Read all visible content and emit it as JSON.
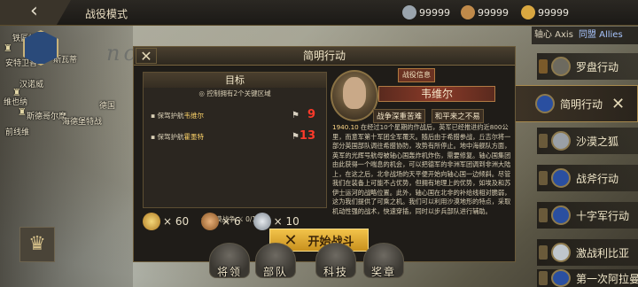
{
  "topbar": {
    "back_icon": "back-arrow-icon",
    "mode_title": "战役模式",
    "resources": [
      {
        "icon": "medal-silver-icon",
        "value": "99999",
        "color": "#9aa4ad"
      },
      {
        "icon": "medal-bronze-icon",
        "value": "99999",
        "color": "#c08a4a"
      },
      {
        "icon": "medal-gold-icon",
        "value": "99999",
        "color": "#d9a740"
      }
    ]
  },
  "map": {
    "labels": [
      "铁匠加州",
      "安特卫普",
      "汉诺威",
      "维也纳",
      "斯德哥尔摩",
      "前线维",
      "斯瓦蒂",
      "德国",
      "海德堡特战"
    ],
    "watermark": "nce"
  },
  "factions": {
    "tab_axis": "轴心 Axis",
    "tab_allies": "同盟 Allies",
    "operations": [
      {
        "name": "罗盘行动",
        "flag_color": "#6d6a5f"
      },
      {
        "name": "简明行动",
        "flag_color": "#2a4fa0"
      },
      {
        "name": "沙漠之狐",
        "flag_color": "#9aa0a6"
      },
      {
        "name": "战斧行动",
        "flag_color": "#2a4fa0"
      },
      {
        "name": "十字军行动",
        "flag_color": "#2a4fa0"
      },
      {
        "name": "激战利比亚",
        "flag_color": "#bfc6cc"
      },
      {
        "name": "第一次阿拉曼",
        "flag_color": "#2a4fa0"
      }
    ]
  },
  "dialog": {
    "title": "简明行动",
    "close_icon": "close-icon",
    "target": {
      "heading": "目标",
      "desc": "控制拥有2个关键区域",
      "objectives": [
        {
          "prefix": "保驾护航",
          "place": "韦维尔",
          "value": "9"
        },
        {
          "prefix": "保驾护航",
          "place": "霍墨特",
          "value": "13"
        }
      ],
      "progress_label": "沙漠战争",
      "progress_value": "0/1000"
    },
    "rewards": [
      {
        "icon": "medal-gold-icon",
        "value": "× 60"
      },
      {
        "icon": "medal-bronze-icon",
        "value": "× 6"
      },
      {
        "icon": "medal-silver-icon",
        "value": "× 10"
      }
    ],
    "general": {
      "battle_info_label": "战役信息",
      "name": "韦维尔",
      "traits": [
        "战争深重苦难",
        "和平来之不易"
      ]
    },
    "story": {
      "date": "1940.10",
      "text": "在经过10个星期的作战后，英军已经推进约近800公里，而意军第十军团全军覆灭。随后由于希腊参战，丘吉尔将一部分英国部队调往希腊协防，攻势有所停止。地中海舰队方面，英军的光辉号航母被轴心国轰炸机炸伤，需要修复。轴心国集团由此获得一个喘息的机会，可以把德军的非洲军团调到非洲大陆上，在这之后，北非战场的天平便开始向轴心国一边倾斜。尽管我们在装备上可能不占优势，但拥有地理上的优势，如埃及和苏伊士运河的战略位置。此外，轴心国在北非的补给线相对脆弱，这为我们提供了可乘之机。我们可以利用沙漠地形的特点，采取机动性强的战术，快速穿插，同时以步兵部队进行辅助。"
    }
  },
  "start_button": {
    "label": "开始战斗",
    "icon": "crossed-swords-icon"
  },
  "bottom_nav": [
    {
      "label": "将领",
      "icon": "general-cap-icon"
    },
    {
      "label": "部队",
      "icon": "tank-icon"
    },
    {
      "label": "科技",
      "icon": "gear-icon"
    },
    {
      "label": "奖章",
      "icon": "medal-icon"
    }
  ],
  "trophy_icon": "trophy-icon",
  "colors": {
    "accent_gold": "#f2c34a",
    "danger_red": "#ff3a2a",
    "panel": "#1f1c18"
  }
}
